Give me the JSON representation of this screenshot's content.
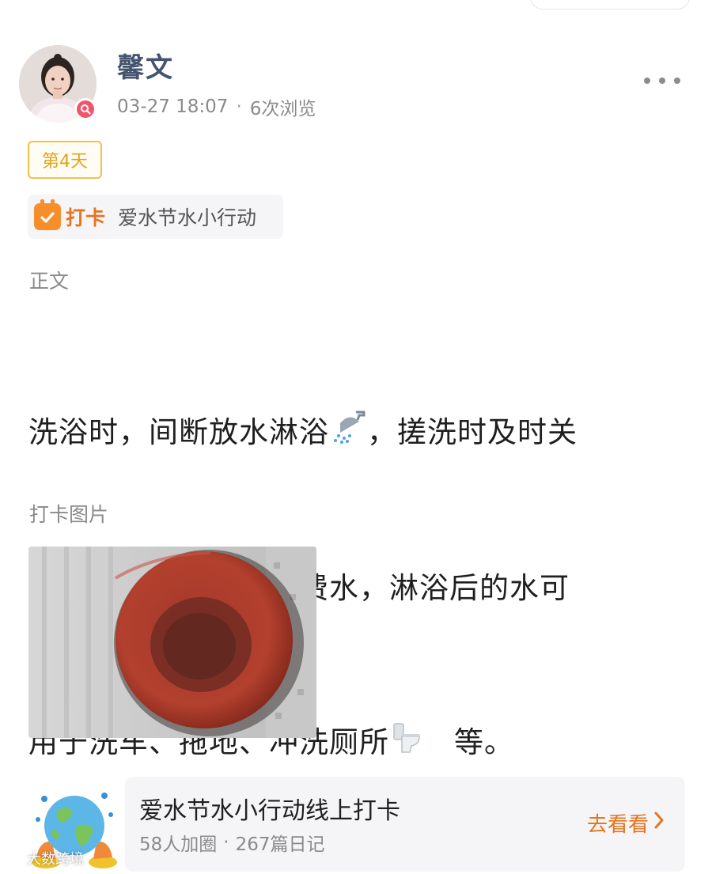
{
  "post": {
    "username": "馨文",
    "date": "03-27 18:07",
    "separator": "·",
    "views": "6次浏览",
    "day_badge": "第4天",
    "checkin_label": "打卡",
    "checkin_topic": "爱水节水小行动",
    "body_section_label": "正文",
    "body_lines": [
      {
        "text": "洗浴时，间断放水淋浴",
        "emoji": "shower-icon",
        "after": "，搓洗时及时关"
      },
      {
        "text": "水，避免过长时间浪费水，淋浴后的水可"
      },
      {
        "text": "用于洗车、拖地、冲洗厕所",
        "emoji": "toilet-icon",
        "after": "　等。"
      }
    ],
    "photo_section_label": "打卡图片"
  },
  "group": {
    "title": "爱水节水小行动线上打卡",
    "members": "58人加圈",
    "separator": "·",
    "diaries": "267篇日记",
    "view_label": "去看看"
  },
  "watermark": {
    "text": "大数跨境"
  },
  "colors": {
    "username": "#45546e",
    "accent_orange": "#e8741f",
    "badge_yellow": "#f0c24b",
    "meta_gray": "#8a8a8a",
    "avatar_badge": "#f0566a"
  }
}
